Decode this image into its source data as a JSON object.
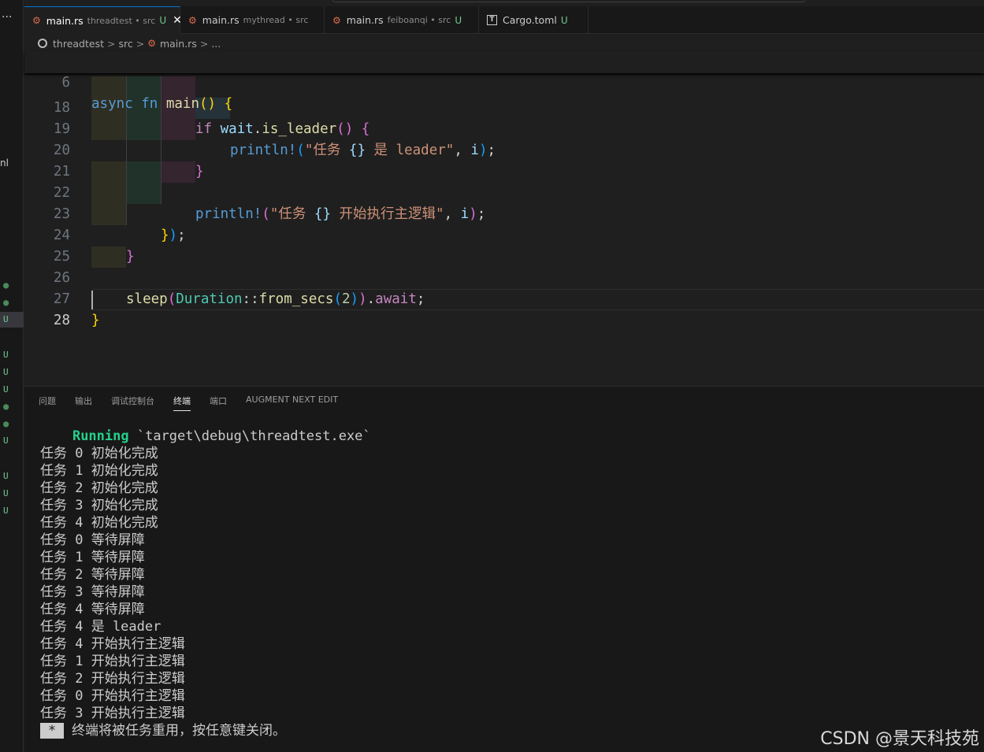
{
  "sidebar": {
    "menu_dots": "···",
    "fragment": "nl",
    "markers": [
      "●",
      "●",
      "U",
      "U",
      "U",
      "U",
      "●",
      "●",
      "U",
      "U",
      "U",
      "U"
    ]
  },
  "tabs": [
    {
      "name": "main.rs",
      "desc": "threadtest • src",
      "badge": "U",
      "close": "✕",
      "icon": "rust-icon",
      "active": true
    },
    {
      "name": "main.rs",
      "desc": "mythread • src",
      "badge": "",
      "icon": "rust-icon",
      "active": false
    },
    {
      "name": "main.rs",
      "desc": "feiboanqi • src",
      "badge": "U",
      "icon": "rust-icon",
      "active": false
    },
    {
      "name": "Cargo.toml",
      "desc": "",
      "badge": "U",
      "icon": "toml-icon",
      "active": false
    }
  ],
  "breadcrumb": {
    "folder": "threadtest",
    "sep1": ">",
    "sub": "src",
    "sep2": ">",
    "file": "main.rs",
    "sep3": ">",
    "more": "..."
  },
  "editor": {
    "sticky_line": {
      "num": "6",
      "text": "async fn main() {"
    },
    "lines": [
      {
        "num": "18",
        "text": "if wait.is_leader() {"
      },
      {
        "num": "19",
        "text": "println!(\"任务 {} 是 leader\", i);"
      },
      {
        "num": "20",
        "text": "}"
      },
      {
        "num": "21",
        "text": ""
      },
      {
        "num": "22",
        "text": "println!(\"任务 {} 开始执行主逻辑\", i);"
      },
      {
        "num": "23",
        "text": "});"
      },
      {
        "num": "24",
        "text": "}"
      },
      {
        "num": "25",
        "text": ""
      },
      {
        "num": "26",
        "text": "sleep(Duration::from_secs(2)).await;"
      },
      {
        "num": "27",
        "text": "}"
      },
      {
        "num": "28",
        "text": ""
      }
    ],
    "current_line": "28"
  },
  "panel": {
    "tabs": [
      "问题",
      "输出",
      "调试控制台",
      "终端",
      "端口",
      "AUGMENT NEXT EDIT"
    ],
    "active_tab": "终端",
    "terminal": {
      "running_label": "Running",
      "running_cmd": " `target\\debug\\threadtest.exe`",
      "lines": [
        "任务 0 初始化完成",
        "任务 1 初始化完成",
        "任务 2 初始化完成",
        "任务 3 初始化完成",
        "任务 4 初始化完成",
        "任务 0 等待屏障",
        "任务 1 等待屏障",
        "任务 2 等待屏障",
        "任务 3 等待屏障",
        "任务 4 等待屏障",
        "任务 4 是 leader",
        "任务 4 开始执行主逻辑",
        "任务 1 开始执行主逻辑",
        "任务 2 开始执行主逻辑",
        "任务 0 开始执行主逻辑",
        "任务 3 开始执行主逻辑"
      ],
      "reuse_star": "*",
      "reuse_msg": "终端将被任务重用，按任意键关闭。"
    }
  },
  "watermark": "CSDN @景天科技苑",
  "colors": {
    "editor_bg": "#1f1f1f",
    "panel_bg": "#181818",
    "accent": "#0078d4",
    "untracked": "#73c991",
    "running": "#23d18b",
    "rust_icon": "#dd6b50"
  }
}
